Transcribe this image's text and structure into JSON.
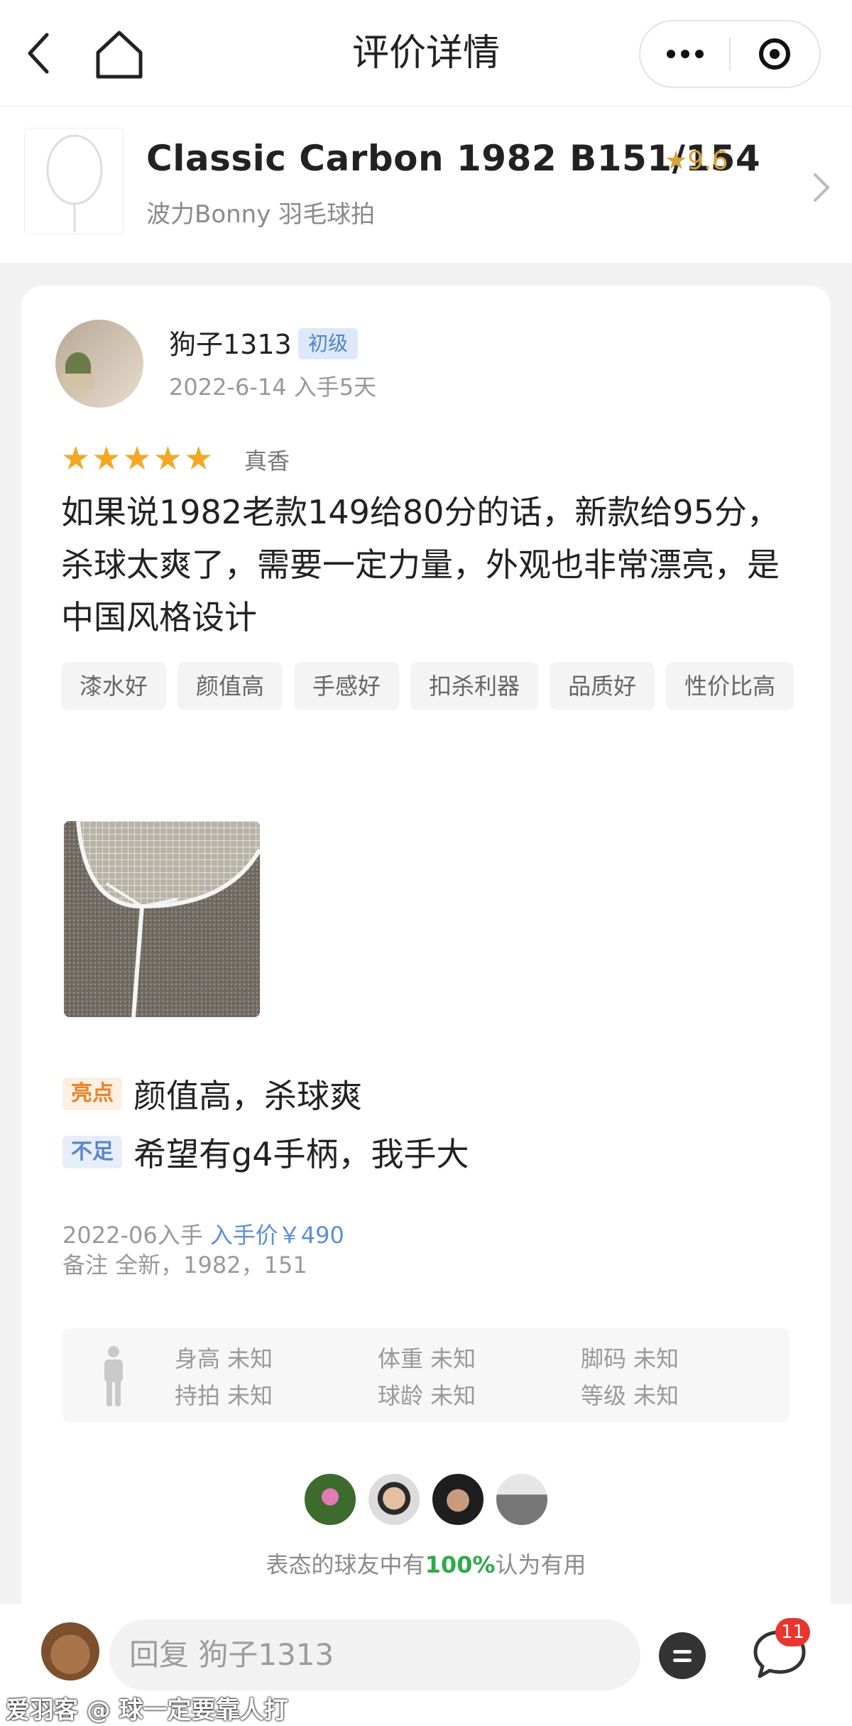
{
  "nav": {
    "title": "评价详情",
    "back_icon": "chevron-left-icon",
    "home_icon": "home-icon",
    "more_icon": "more-dots-icon",
    "close_icon": "target-icon"
  },
  "product": {
    "name": "Classic Carbon 1982 B151/154",
    "score": "★9.6",
    "brand": "波力Bonny 羽毛球拍"
  },
  "review": {
    "user": "狗子1313",
    "level": "初级",
    "date": "2022-6-14 入手5天",
    "stars": 5,
    "rating_word": "真香",
    "content": "如果说1982老款149给80分的话，新款给95分，杀球太爽了，需要一定力量，外观也非常漂亮，是中国风格设计",
    "tags": [
      "漆水好",
      "颜值高",
      "手感好",
      "扣杀利器",
      "品质好",
      "性价比高"
    ],
    "pros_label": "亮点",
    "pros": "颜值高，杀球爽",
    "cons_label": "不足",
    "cons": "希望有g4手柄，我手大",
    "purchase": "2022-06入手",
    "price": "入手价￥490",
    "note": "备注 全新，1982，151"
  },
  "body_info": {
    "height": "身高 未知",
    "weight": "体重 未知",
    "shoe": "脚码 未知",
    "grip": "持拍 未知",
    "years": "球龄 未知",
    "grade": "等级 未知"
  },
  "useful": {
    "prefix": "表态的球友中有",
    "percent": "100%",
    "suffix": "认为有用"
  },
  "bottom": {
    "reply_placeholder": "回复 狗子1313",
    "comment_count": "11"
  },
  "watermark": "爱羽客 @ 球一定要靠人打",
  "colors": {
    "star": "#f4a723",
    "pros": "#e8832a",
    "cons": "#5a86c8",
    "price": "#5b8fd6",
    "useful": "#2eaa4a"
  }
}
